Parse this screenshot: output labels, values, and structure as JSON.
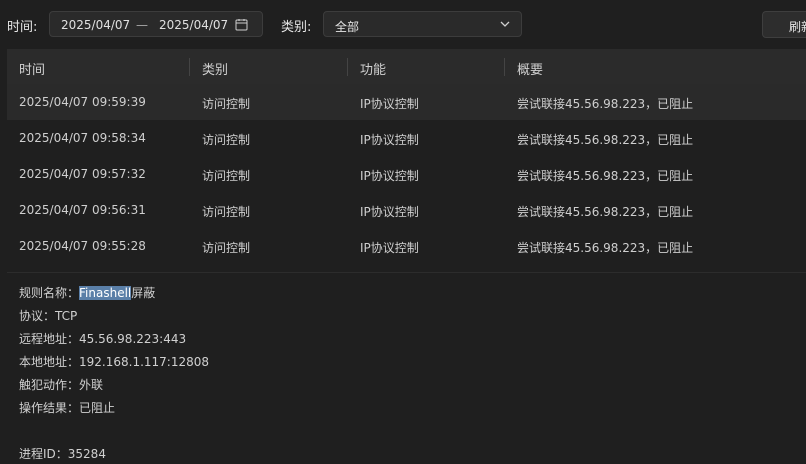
{
  "filters": {
    "time_label": "时间:",
    "date_start": "2025/04/07",
    "date_separator": "—",
    "date_end": "2025/04/07",
    "category_label": "类别:",
    "category_value": "全部",
    "refresh_label": "刷新"
  },
  "table": {
    "headers": [
      "时间",
      "类别",
      "功能",
      "概要"
    ],
    "rows": [
      {
        "time": "2025/04/07 09:59:39",
        "category": "访问控制",
        "function": "IP协议控制",
        "summary": "尝试联接45.56.98.223，已阻止"
      },
      {
        "time": "2025/04/07 09:58:34",
        "category": "访问控制",
        "function": "IP协议控制",
        "summary": "尝试联接45.56.98.223，已阻止"
      },
      {
        "time": "2025/04/07 09:57:32",
        "category": "访问控制",
        "function": "IP协议控制",
        "summary": "尝试联接45.56.98.223，已阻止"
      },
      {
        "time": "2025/04/07 09:56:31",
        "category": "访问控制",
        "function": "IP协议控制",
        "summary": "尝试联接45.56.98.223，已阻止"
      },
      {
        "time": "2025/04/07 09:55:28",
        "category": "访问控制",
        "function": "IP协议控制",
        "summary": "尝试联接45.56.98.223，已阻止"
      }
    ]
  },
  "detail": {
    "rule_label": "规则名称：",
    "rule_highlight": "Finashell",
    "rule_rest": "屏蔽",
    "protocol": "协议：TCP",
    "remote": "远程地址：45.56.98.223:443",
    "local": "本地地址：192.168.1.117:12808",
    "action": "触犯动作：外联",
    "result": "操作结果：已阻止",
    "pid": "进程ID：35284"
  },
  "colors": {
    "background": "#1f1f1f",
    "header": "#2b2b2b",
    "selection": "#5a7fa8"
  }
}
